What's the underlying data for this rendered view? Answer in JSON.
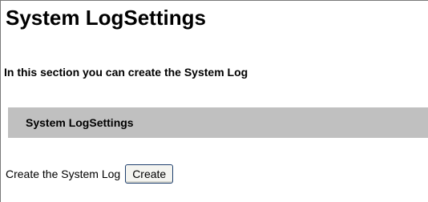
{
  "page": {
    "title": "System LogSettings",
    "intro": "In this section you can create the System Log"
  },
  "section": {
    "header": "System LogSettings",
    "create_label": "Create the System Log",
    "create_button": "Create"
  }
}
